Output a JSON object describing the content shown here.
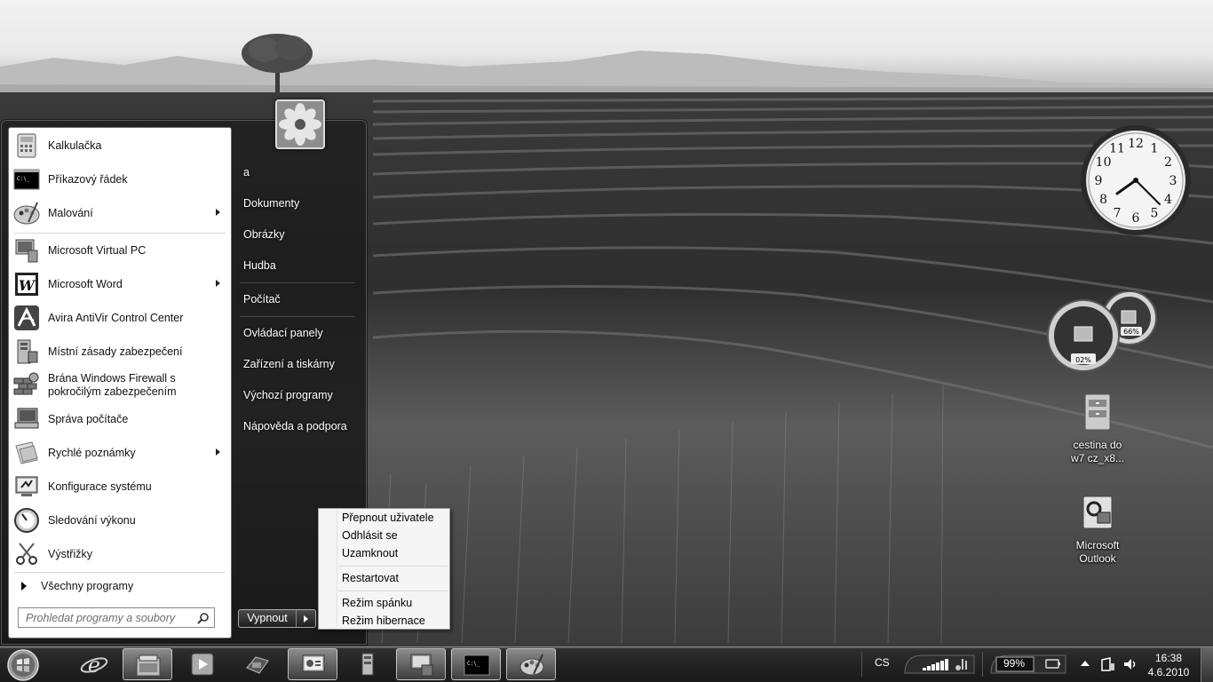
{
  "start_menu": {
    "pinned": [
      {
        "label": "Kalkulačka",
        "icon": "calculator-icon",
        "submenu": false
      },
      {
        "label": "Příkazový řádek",
        "icon": "command-prompt-icon",
        "submenu": false
      },
      {
        "label": "Malování",
        "icon": "paint-icon",
        "submenu": true
      }
    ],
    "recent": [
      {
        "label": "Microsoft Virtual PC",
        "icon": "virtual-pc-icon",
        "submenu": false
      },
      {
        "label": "Microsoft Word",
        "icon": "word-icon",
        "submenu": true
      },
      {
        "label": "Avira AntiVir Control Center",
        "icon": "avira-icon",
        "submenu": false
      },
      {
        "label": "Místní zásady zabezpečení",
        "icon": "security-policy-icon",
        "submenu": false
      },
      {
        "label_line1": "Brána Windows Firewall s",
        "label_line2": "pokročilým zabezpečením",
        "icon": "firewall-icon",
        "submenu": false
      },
      {
        "label": "Správa počítače",
        "icon": "computer-management-icon",
        "submenu": false
      },
      {
        "label": "Rychlé poznámky",
        "icon": "sticky-notes-icon",
        "submenu": true
      },
      {
        "label": "Konfigurace systému",
        "icon": "system-config-icon",
        "submenu": false
      },
      {
        "label": "Sledování výkonu",
        "icon": "performance-monitor-icon",
        "submenu": false
      },
      {
        "label": "Výstřižky",
        "icon": "snipping-tool-icon",
        "submenu": false
      }
    ],
    "all_programs": "Všechny programy",
    "search_placeholder": "Prohledat programy a soubory",
    "right_items": {
      "user": "a",
      "documents": "Dokumenty",
      "pictures": "Obrázky",
      "music": "Hudba",
      "computer": "Počítač",
      "control_panel": "Ovládací panely",
      "devices": "Zařízení a tiskárny",
      "default_programs": "Výchozí programy",
      "help": "Nápověda a podpora"
    },
    "shutdown_label": "Vypnout"
  },
  "shutdown_menu": {
    "switch_user": "Přepnout uživatele",
    "log_off": "Odhlásit se",
    "lock": "Uzamknout",
    "restart": "Restartovat",
    "sleep": "Režim spánku",
    "hibernate": "Režim hibernace"
  },
  "desktop": {
    "icons": [
      {
        "label_line1": "cestina do",
        "label_line2": "w7 cz_x8...",
        "icon": "archive-icon"
      },
      {
        "label_line1": "Microsoft",
        "label_line2": "Outlook",
        "icon": "outlook-icon"
      }
    ],
    "meter": {
      "cpu": "02%",
      "memory": "66%"
    },
    "clock_numbers": [
      "12",
      "1",
      "2",
      "3",
      "4",
      "5",
      "6",
      "7",
      "8",
      "9",
      "10",
      "11"
    ]
  },
  "taskbar": {
    "buttons": [
      {
        "icon": "internet-explorer-icon",
        "active": false
      },
      {
        "icon": "explorer-icon",
        "active": true
      },
      {
        "icon": "media-player-icon",
        "active": false
      },
      {
        "icon": "virtual-pc-icon",
        "active": false
      },
      {
        "icon": "system-config-icon",
        "active": true
      },
      {
        "icon": "security-policy-icon",
        "active": false
      },
      {
        "icon": "computer-management-icon",
        "active": true
      },
      {
        "icon": "command-prompt-icon",
        "active": true
      },
      {
        "icon": "paint-icon",
        "active": true
      }
    ],
    "language": "CS",
    "battery": "99%",
    "time": "16:38",
    "date": "4.6.2010"
  }
}
